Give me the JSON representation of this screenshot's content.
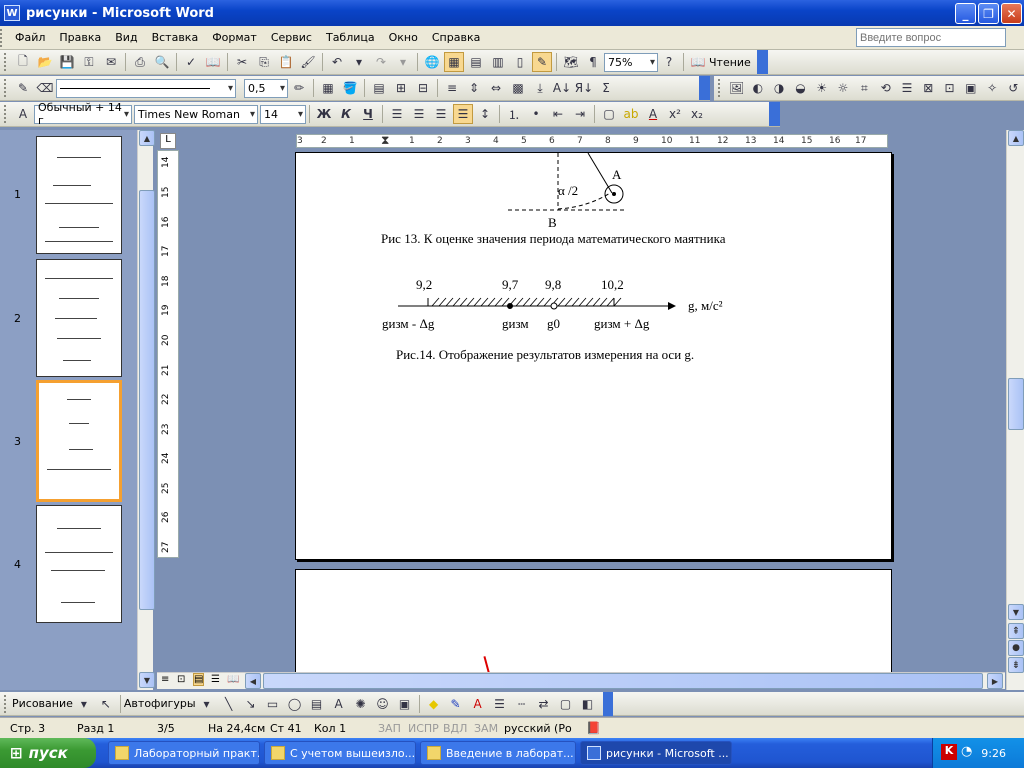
{
  "window": {
    "title": "рисунки - Microsoft Word"
  },
  "menu": {
    "items": [
      "Файл",
      "Правка",
      "Вид",
      "Вставка",
      "Формат",
      "Сервис",
      "Таблица",
      "Окно",
      "Справка"
    ],
    "help_placeholder": "Введите вопрос"
  },
  "toolbar_standard": {
    "zoom": "75%",
    "read_label": "Чтение"
  },
  "toolbar_tables": {
    "line_weight": "0,5"
  },
  "toolbar_format": {
    "style": "Обычный + 14 г",
    "font": "Times New Roman",
    "size": "14",
    "bold": "Ж",
    "italic": "К",
    "underline": "Ч"
  },
  "ruler_h": [
    "3",
    "2",
    "1",
    "1",
    "2",
    "3",
    "4",
    "5",
    "6",
    "7",
    "8",
    "9",
    "10",
    "11",
    "12",
    "13",
    "14",
    "15",
    "16",
    "17"
  ],
  "ruler_v": [
    "14",
    "15",
    "16",
    "17",
    "18",
    "19",
    "20",
    "21",
    "22",
    "23",
    "24",
    "25",
    "26",
    "27"
  ],
  "thumbnails": [
    {
      "num": "1"
    },
    {
      "num": "2"
    },
    {
      "num": "3",
      "selected": true
    },
    {
      "num": "4"
    }
  ],
  "document": {
    "fig13": {
      "label_a": "A",
      "label_alpha": "α /2",
      "label_b": "B",
      "caption": "Рис 13. К оценке значения периода математического маятника"
    },
    "fig14": {
      "ticks": [
        "9,2",
        "9,7",
        "9,8",
        "10,2"
      ],
      "axis_label": "g, м/с²",
      "below_left": "gизм - Δg",
      "below_mid": "gизм",
      "below_g0": "g0",
      "below_right": "gизм + Δg",
      "caption": "Рис.14. Отображение результатов измерения на оси g."
    }
  },
  "drawbar": {
    "draw_label": "Рисование",
    "autoshapes_label": "Автофигуры"
  },
  "status": {
    "page": "Стр. 3",
    "section": "Разд 1",
    "pages": "3/5",
    "at": "На 24,4см",
    "line": "Ст 41",
    "col": "Кол 1",
    "rec": "ЗАП",
    "trk": "ИСПР",
    "ext": "ВДЛ",
    "ovr": "ЗАМ",
    "lang": "русский (Ро"
  },
  "taskbar": {
    "start": "пуск",
    "tasks": [
      "Лабораторный практ...",
      "С учетом вышеизло...",
      "Введение в лаборат...",
      "рисунки - Microsoft ..."
    ],
    "clock": "9:26"
  }
}
